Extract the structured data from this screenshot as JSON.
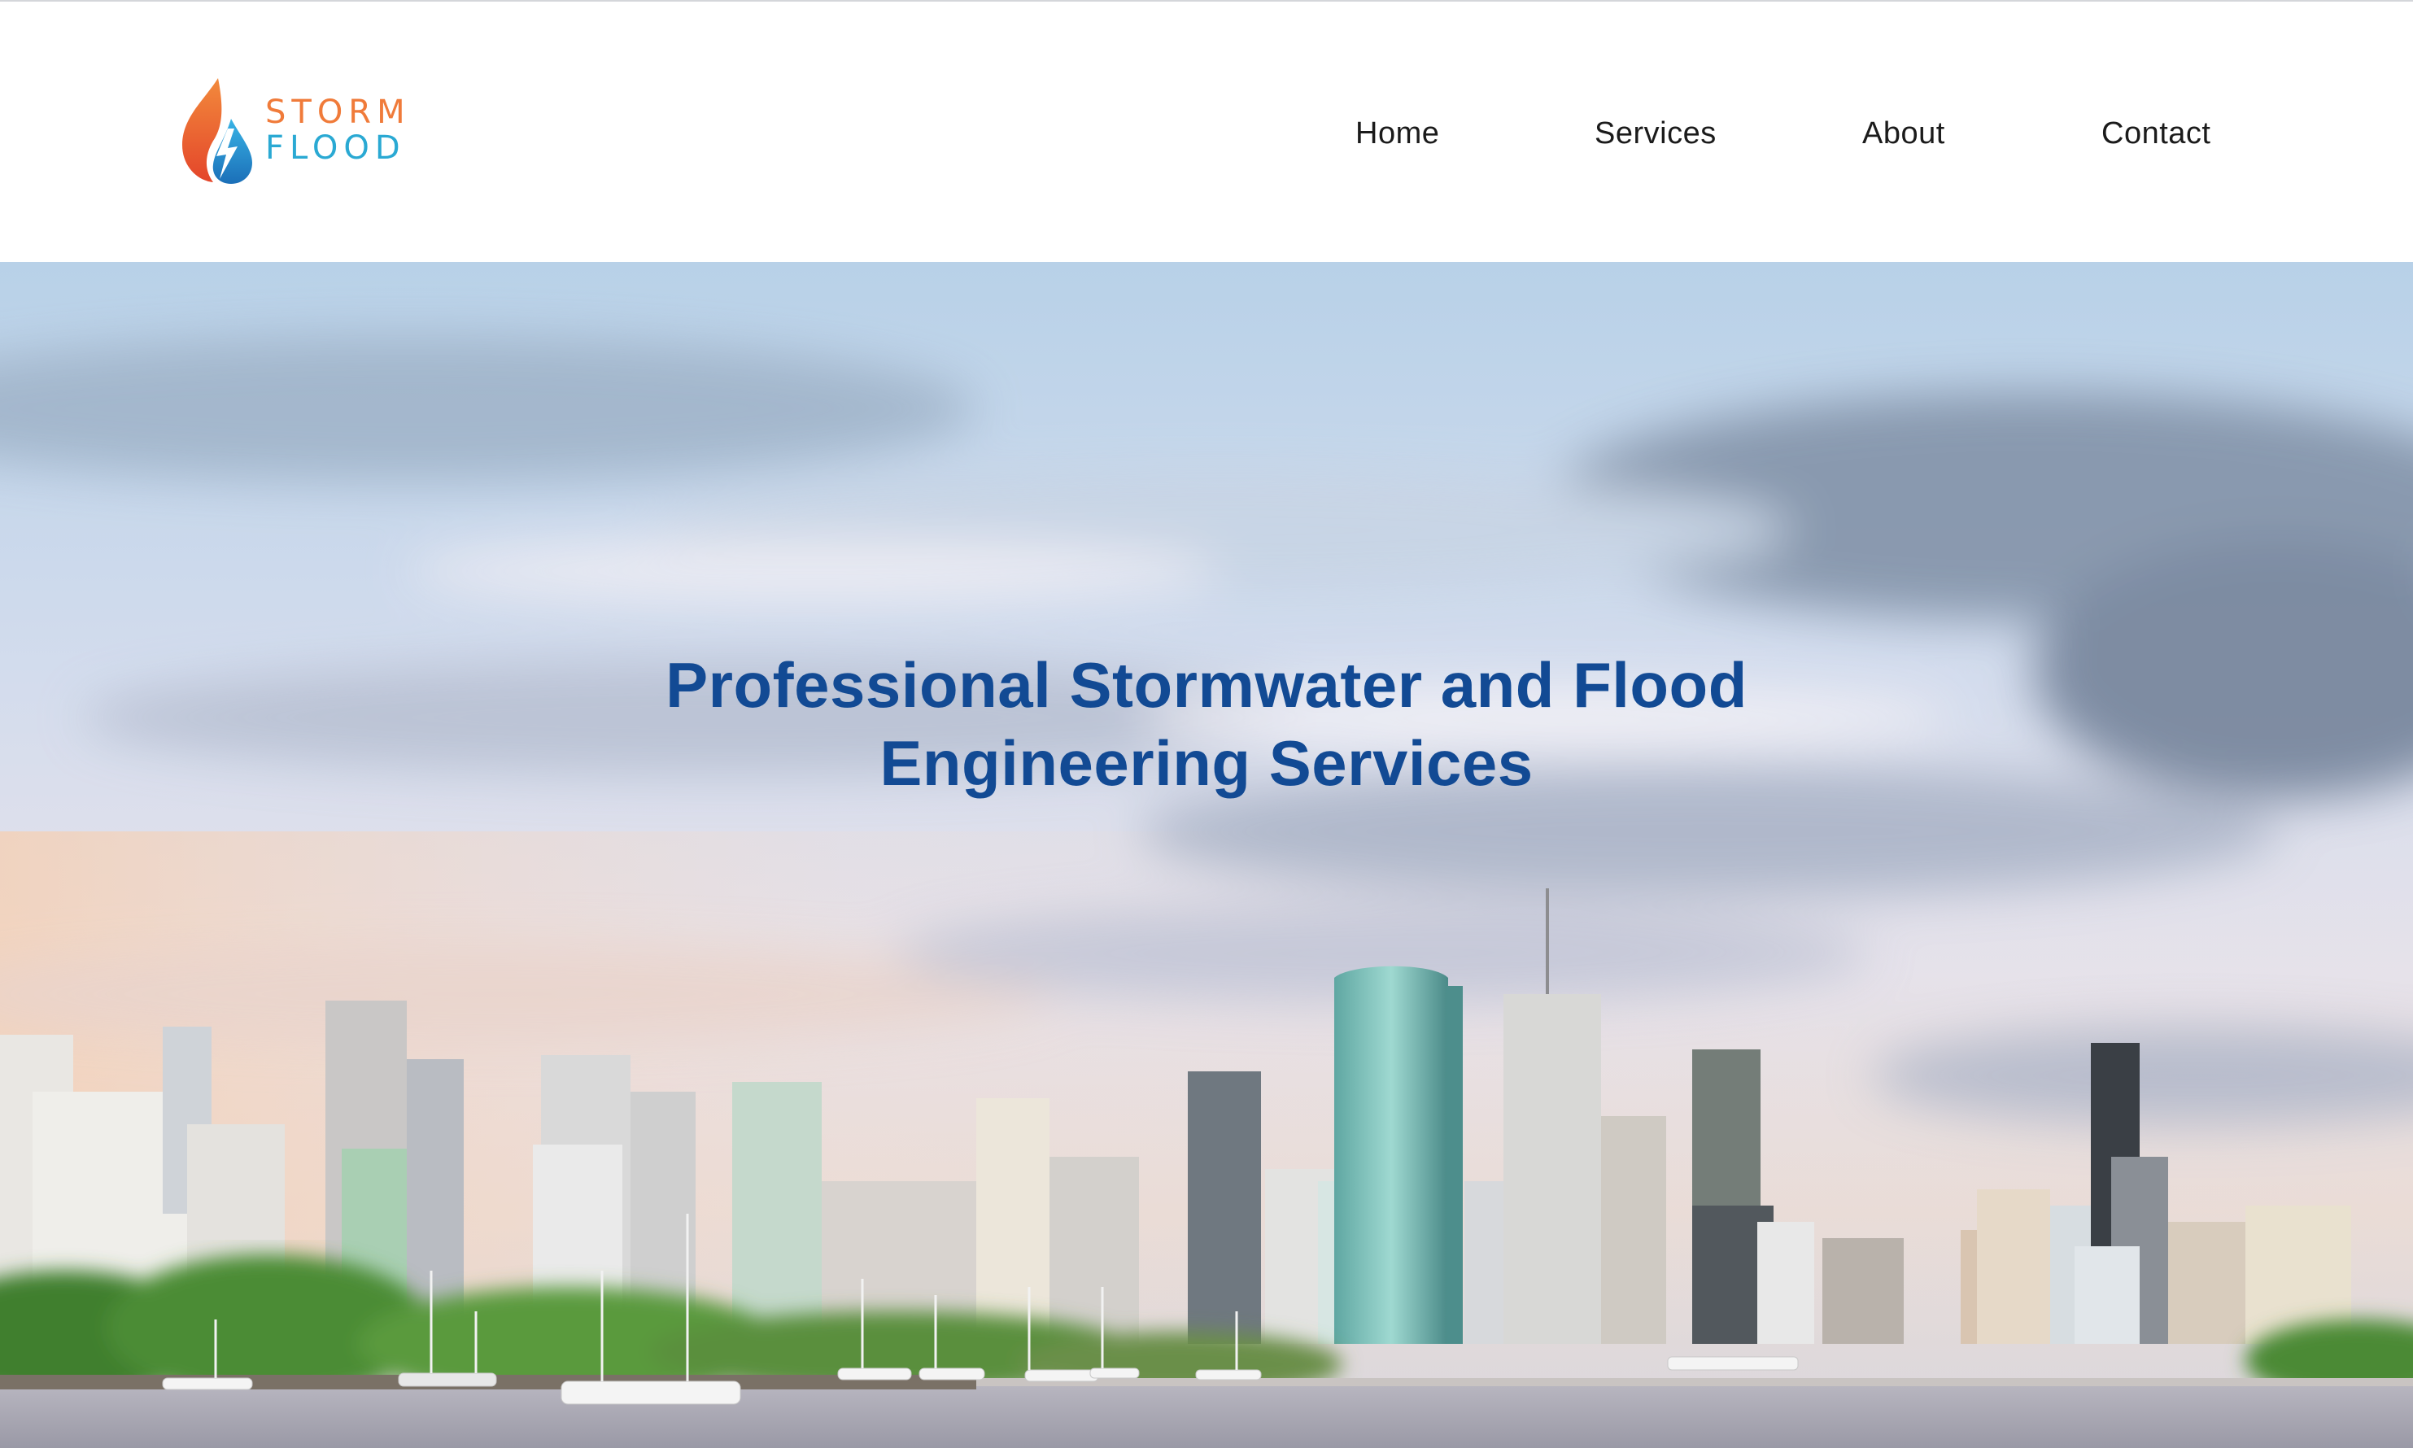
{
  "brand": {
    "name_line1": "STORM",
    "name_line2": "FLOOD",
    "colors": {
      "orange": "#f07b3a",
      "blue": "#2aa9d3",
      "flame": "#e8562a",
      "drop": "#1f8fcf"
    }
  },
  "nav": {
    "items": [
      {
        "label": "Home"
      },
      {
        "label": "Services"
      },
      {
        "label": "About"
      },
      {
        "label": "Contact"
      }
    ]
  },
  "hero": {
    "title_line1": "Professional Stormwater and Flood",
    "title_line2": "Engineering Services",
    "title_color": "#124a94",
    "image": "city-skyline-river-photo"
  }
}
